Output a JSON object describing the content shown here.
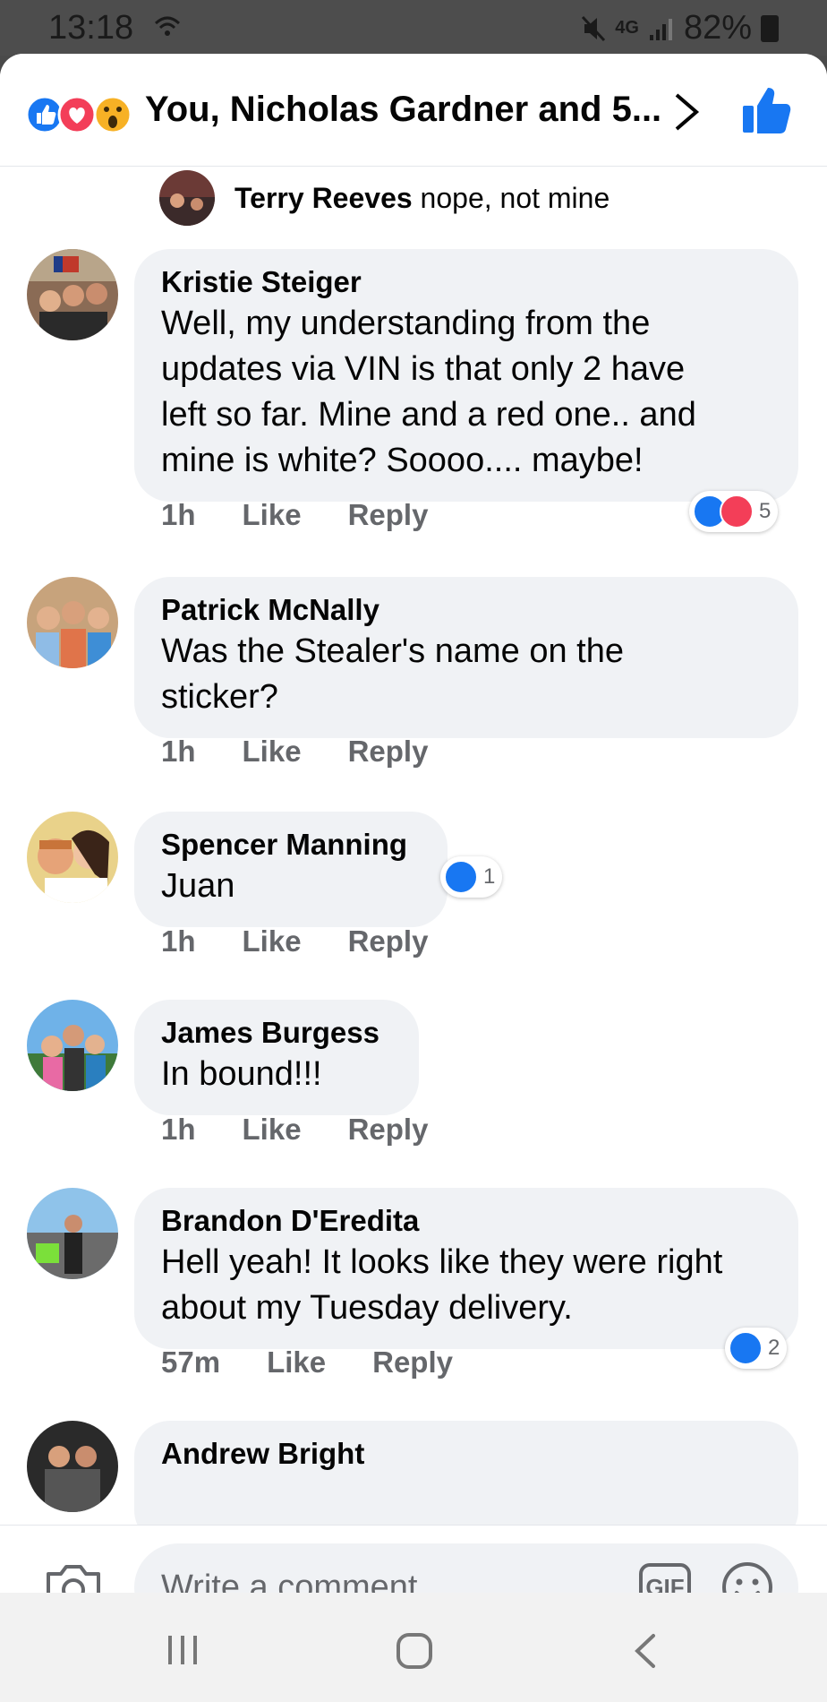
{
  "status_bar": {
    "time": "13:18",
    "network": "4G",
    "battery": "82%"
  },
  "header": {
    "title": "You, Nicholas Gardner and 5..."
  },
  "top_reply": {
    "name": "Terry Reeves",
    "text": "nope, not mine"
  },
  "comments": [
    {
      "name": "Kristie Steiger",
      "lines": [
        "Well, my understanding from the",
        "updates via VIN is that only 2 have",
        "left so far. Mine and a red one.. and",
        "mine is white? Soooo.... maybe!"
      ],
      "time": "1h",
      "like": "Like",
      "reply": "Reply",
      "reaction_count": "5"
    },
    {
      "name": "Patrick McNally",
      "lines": [
        "Was the Stealer's name on the",
        "sticker?"
      ],
      "time": "1h",
      "like": "Like",
      "reply": "Reply"
    },
    {
      "name": "Spencer Manning",
      "lines": [
        "Juan"
      ],
      "time": "1h",
      "like": "Like",
      "reply": "Reply",
      "reaction_count": "1"
    },
    {
      "name": "James Burgess",
      "lines": [
        "In bound!!!"
      ],
      "time": "1h",
      "like": "Like",
      "reply": "Reply"
    },
    {
      "name": "Brandon D'Eredita",
      "lines": [
        "Hell yeah! It looks like they were right",
        "about my Tuesday delivery."
      ],
      "time": "57m",
      "like": "Like",
      "reply": "Reply",
      "reaction_count": "2"
    },
    {
      "name": "Andrew Bright"
    }
  ],
  "composer": {
    "placeholder": "Write a comment...",
    "gif_label": "GIF"
  },
  "colors": {
    "facebook_blue": "#1877f2",
    "love_red": "#f33e58",
    "bubble_bg": "#f0f2f5",
    "meta_gray": "#65676b"
  }
}
